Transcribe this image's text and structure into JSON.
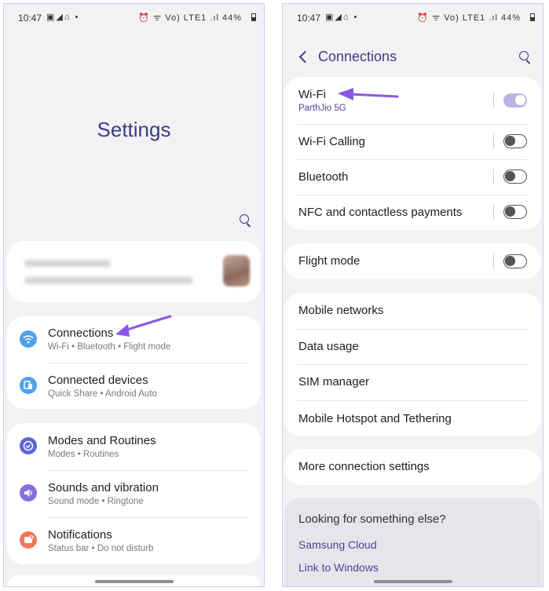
{
  "status_bar": {
    "time": "10:47",
    "left_icons": "▣◢⌂ •",
    "right_icons": "⏰ ᯤ Vo) LTE1 .ıl",
    "battery": "44%"
  },
  "left": {
    "title": "Settings",
    "items": [
      {
        "title": "Connections",
        "subtitle": "Wi-Fi • Bluetooth • Flight mode",
        "icon": "wifi-icon",
        "color": "#4fa1ee"
      },
      {
        "title": "Connected devices",
        "subtitle": "Quick Share • Android Auto",
        "icon": "connected-devices-icon",
        "color": "#4fa1ee"
      },
      {
        "title": "Modes and Routines",
        "subtitle": "Modes • Routines",
        "icon": "check-circle-icon",
        "color": "#5e63d3"
      },
      {
        "title": "Sounds and vibration",
        "subtitle": "Sound mode • Ringtone",
        "icon": "speaker-icon",
        "color": "#8a6de0"
      },
      {
        "title": "Notifications",
        "subtitle": "Status bar • Do not disturb",
        "icon": "notification-icon",
        "color": "#f0765c"
      }
    ]
  },
  "right": {
    "title": "Connections",
    "wifi": {
      "title": "Wi-Fi",
      "subtitle": "ParthJio 5G",
      "on": true
    },
    "wifi_calling": {
      "title": "Wi-Fi Calling",
      "on": false
    },
    "bluetooth": {
      "title": "Bluetooth",
      "on": false
    },
    "nfc": {
      "title": "NFC and contactless payments",
      "on": false
    },
    "flight_mode": {
      "title": "Flight mode",
      "on": false
    },
    "list": [
      "Mobile networks",
      "Data usage",
      "SIM manager",
      "Mobile Hotspot and Tethering"
    ],
    "more": "More connection settings",
    "footer": {
      "heading": "Looking for something else?",
      "links": [
        "Samsung Cloud",
        "Link to Windows"
      ]
    }
  },
  "colors": {
    "accent": "#3f3a86",
    "annotation_arrow": "#8b57e8"
  }
}
